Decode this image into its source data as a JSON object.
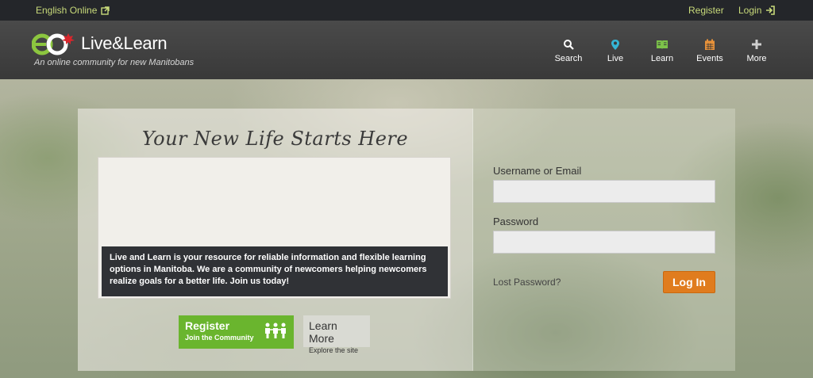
{
  "topbar": {
    "language": "English Online",
    "register": "Register",
    "login": "Login"
  },
  "header": {
    "logo_text": "Live&Learn",
    "tagline": "An online community for new Manitobans",
    "nav": [
      {
        "label": "Search",
        "icon": "search-icon",
        "color": "#ffffff"
      },
      {
        "label": "Live",
        "icon": "map-pin-icon",
        "color": "#35b6d6"
      },
      {
        "label": "Learn",
        "icon": "book-icon",
        "color": "#7cc24a"
      },
      {
        "label": "Events",
        "icon": "calendar-icon",
        "color": "#e8923a"
      },
      {
        "label": "More",
        "icon": "plus-icon",
        "color": "#cfcfcf"
      }
    ]
  },
  "hero": {
    "headline": "Your New Life Starts Here",
    "description": "Live and Learn is your resource for reliable information and flexible learning options in Manitoba. We are a community of newcomers helping newcomers realize goals for a better life. Join us today!",
    "register_button": {
      "title": "Register",
      "subtitle": "Join the Community"
    },
    "learn_button": {
      "title": "Learn More",
      "subtitle": "Explore the site"
    }
  },
  "login_form": {
    "username_label": "Username or Email",
    "username_value": "",
    "password_label": "Password",
    "password_value": "",
    "lost_password": "Lost Password?",
    "submit": "Log In"
  },
  "colors": {
    "accent_green": "#6ab52e",
    "login_orange": "#e07c1e",
    "topbar_link": "#c8da7a"
  }
}
